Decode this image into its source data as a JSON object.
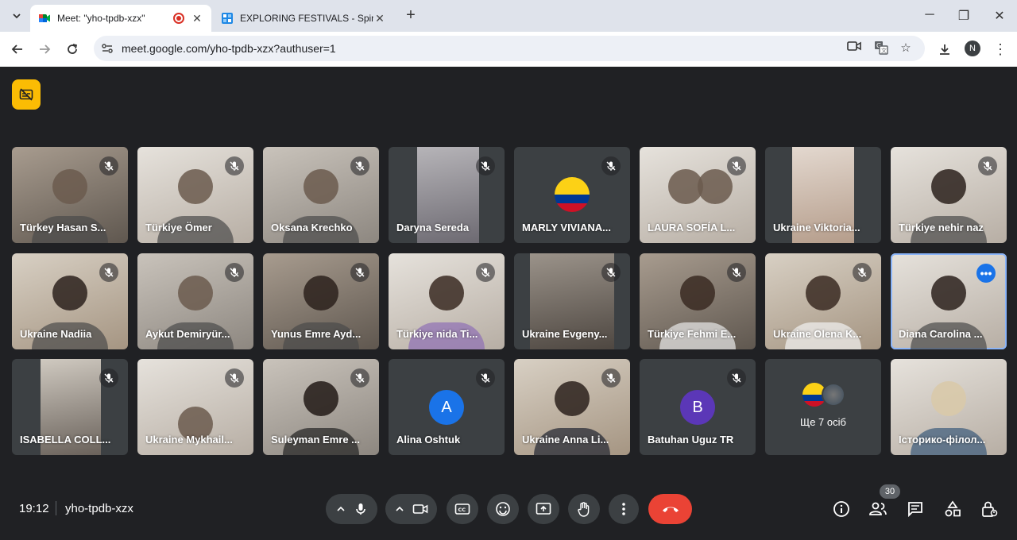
{
  "browser": {
    "tabs": [
      {
        "title": "Meet: \"yho-tpdb-xzx\"",
        "active": true,
        "recording": true
      },
      {
        "title": "EXPLORING FESTIVALS - Spin the whe",
        "active": false
      }
    ],
    "url": "meet.google.com/yho-tpdb-xzx?authuser=1",
    "profile_initial": "N"
  },
  "meet": {
    "participants": [
      {
        "name": "Türkey Hasan S...",
        "type": "video",
        "muted": true
      },
      {
        "name": "Türkiye Ömer",
        "type": "video",
        "muted": true
      },
      {
        "name": "Oksana Krechko",
        "type": "video",
        "muted": true
      },
      {
        "name": "Daryna Sereda",
        "type": "video",
        "muted": true
      },
      {
        "name": "MARLY VIVIANA...",
        "type": "flag",
        "muted": true
      },
      {
        "name": "LAURA SOFÍA L...",
        "type": "video",
        "muted": true
      },
      {
        "name": "Ukraine Viktoria...",
        "type": "video",
        "muted": false
      },
      {
        "name": "Türkiye nehir naz",
        "type": "video",
        "muted": true
      },
      {
        "name": "Ukraine Nadiia",
        "type": "video",
        "muted": true
      },
      {
        "name": "Aykut Demiryür...",
        "type": "video",
        "muted": true
      },
      {
        "name": "Yunus Emre Ayd...",
        "type": "video",
        "muted": true
      },
      {
        "name": "Türkiye nida Ti...",
        "type": "video",
        "muted": true
      },
      {
        "name": "Ukraine Evgeny...",
        "type": "video",
        "muted": true
      },
      {
        "name": "Türkiye Fehmi E...",
        "type": "video",
        "muted": true
      },
      {
        "name": "Ukraine Olena K...",
        "type": "video",
        "muted": true
      },
      {
        "name": "Diana Carolina ...",
        "type": "video",
        "muted": false,
        "speaking": true
      },
      {
        "name": "ISABELLA COLL...",
        "type": "video",
        "muted": true
      },
      {
        "name": "Ukraine Mykhail...",
        "type": "video",
        "muted": true
      },
      {
        "name": "Suleyman Emre ...",
        "type": "video",
        "muted": true
      },
      {
        "name": "Alina Oshtuk",
        "type": "letter",
        "letter": "A",
        "color": "#1a73e8",
        "muted": true
      },
      {
        "name": "Ukraine Anna Li...",
        "type": "video",
        "muted": true
      },
      {
        "name": "Batuhan Uguz TR",
        "type": "letter",
        "letter": "B",
        "color": "#5b37b7",
        "muted": true
      },
      {
        "name": "Ще 7 осіб",
        "type": "others",
        "muted": false
      },
      {
        "name": "Історико-філол...",
        "type": "video",
        "muted": false
      }
    ],
    "clock": "19:12",
    "meeting_code": "yho-tpdb-xzx",
    "people_count": "30"
  },
  "colors": {
    "background": "#202124",
    "tile": "#3c4043",
    "end_call": "#ea4335",
    "accent": "#1a73e8",
    "notice": "#fbbc04"
  }
}
